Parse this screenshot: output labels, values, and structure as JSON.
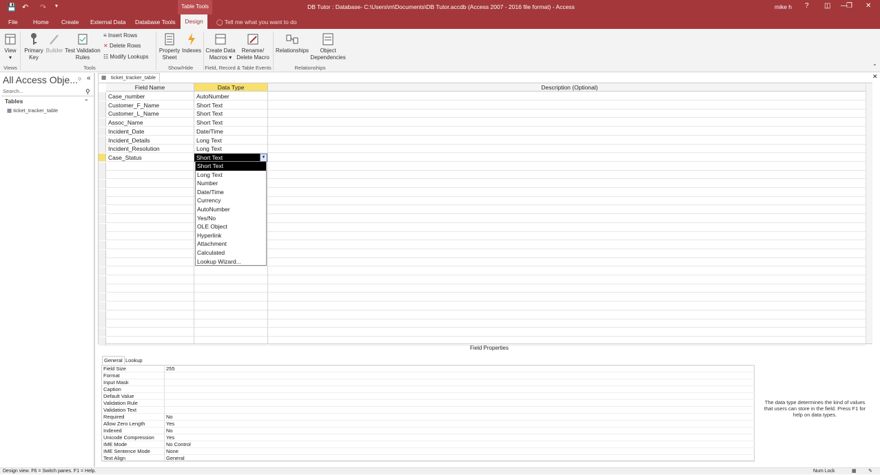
{
  "titlebar": {
    "tools_label": "Table Tools",
    "title": "DB Tutor : Database- C:\\Users\\m\\Documents\\DB Tutor.accdb (Access 2007 - 2016 file format) - Access",
    "user": "mike h",
    "help": "?"
  },
  "tabs": {
    "file": "File",
    "home": "Home",
    "create": "Create",
    "external": "External Data",
    "dbtools": "Database Tools",
    "design": "Design",
    "tellme": "Tell me what you want to do"
  },
  "ribbon": {
    "view": "View",
    "primary_key": "Primary Key",
    "builder": "Builder",
    "test_validation": "Test Validation Rules",
    "insert_rows": "Insert Rows",
    "delete_rows": "Delete Rows",
    "modify_lookups": "Modify Lookups",
    "property_sheet": "Property Sheet",
    "indexes": "Indexes",
    "create_macros": "Create Data Macros",
    "rename_macro": "Rename/ Delete Macro",
    "relationships": "Relationships",
    "object_dependencies": "Object Dependencies",
    "grp_views": "Views",
    "grp_tools": "Tools",
    "grp_showhide": "Show/Hide",
    "grp_events": "Field, Record & Table Events",
    "grp_rel": "Relationships"
  },
  "nav": {
    "title": "All Access Obje...",
    "search_placeholder": "Search...",
    "section": "Tables",
    "item": "ticket_tracker_table"
  },
  "doc_tab": "ticket_tracker_table",
  "grid": {
    "headers": {
      "field": "Field Name",
      "type": "Data Type",
      "desc": "Description (Optional)"
    },
    "rows": [
      {
        "field": "Case_number",
        "type": "AutoNumber"
      },
      {
        "field": "Customer_F_Name",
        "type": "Short Text"
      },
      {
        "field": "Customer_L_Name",
        "type": "Short Text"
      },
      {
        "field": "Assoc_Name",
        "type": "Short Text"
      },
      {
        "field": "Incident_Date",
        "type": "Date/Time"
      },
      {
        "field": "Incident_Details",
        "type": "Long Text"
      },
      {
        "field": "Incident_Resolution",
        "type": "Long Text"
      },
      {
        "field": "Case_Status",
        "type": "Short Text"
      }
    ]
  },
  "dropdown": [
    "Short Text",
    "Long Text",
    "Number",
    "Date/Time",
    "Currency",
    "AutoNumber",
    "Yes/No",
    "OLE Object",
    "Hyperlink",
    "Attachment",
    "Calculated",
    "Lookup Wizard..."
  ],
  "field_properties": {
    "title": "Field Properties",
    "tabs": [
      "General",
      "Lookup"
    ],
    "rows": [
      {
        "label": "Field Size",
        "value": "255"
      },
      {
        "label": "Format",
        "value": ""
      },
      {
        "label": "Input Mask",
        "value": ""
      },
      {
        "label": "Caption",
        "value": ""
      },
      {
        "label": "Default Value",
        "value": ""
      },
      {
        "label": "Validation Rule",
        "value": ""
      },
      {
        "label": "Validation Text",
        "value": ""
      },
      {
        "label": "Required",
        "value": "No"
      },
      {
        "label": "Allow Zero Length",
        "value": "Yes"
      },
      {
        "label": "Indexed",
        "value": "No"
      },
      {
        "label": "Unicode Compression",
        "value": "Yes"
      },
      {
        "label": "IME Mode",
        "value": "No Control"
      },
      {
        "label": "IME Sentence Mode",
        "value": "None"
      },
      {
        "label": "Text Align",
        "value": "General"
      }
    ],
    "help": "The data type determines the kind of values that users can store in the field. Press F1 for help on data types."
  },
  "status": {
    "left": "Design view.  F6 = Switch panes.  F1 = Help.",
    "numlock": "Num Lock"
  },
  "colors": {
    "accent": "#a4373a",
    "header_highlight": "#f7e06e"
  }
}
